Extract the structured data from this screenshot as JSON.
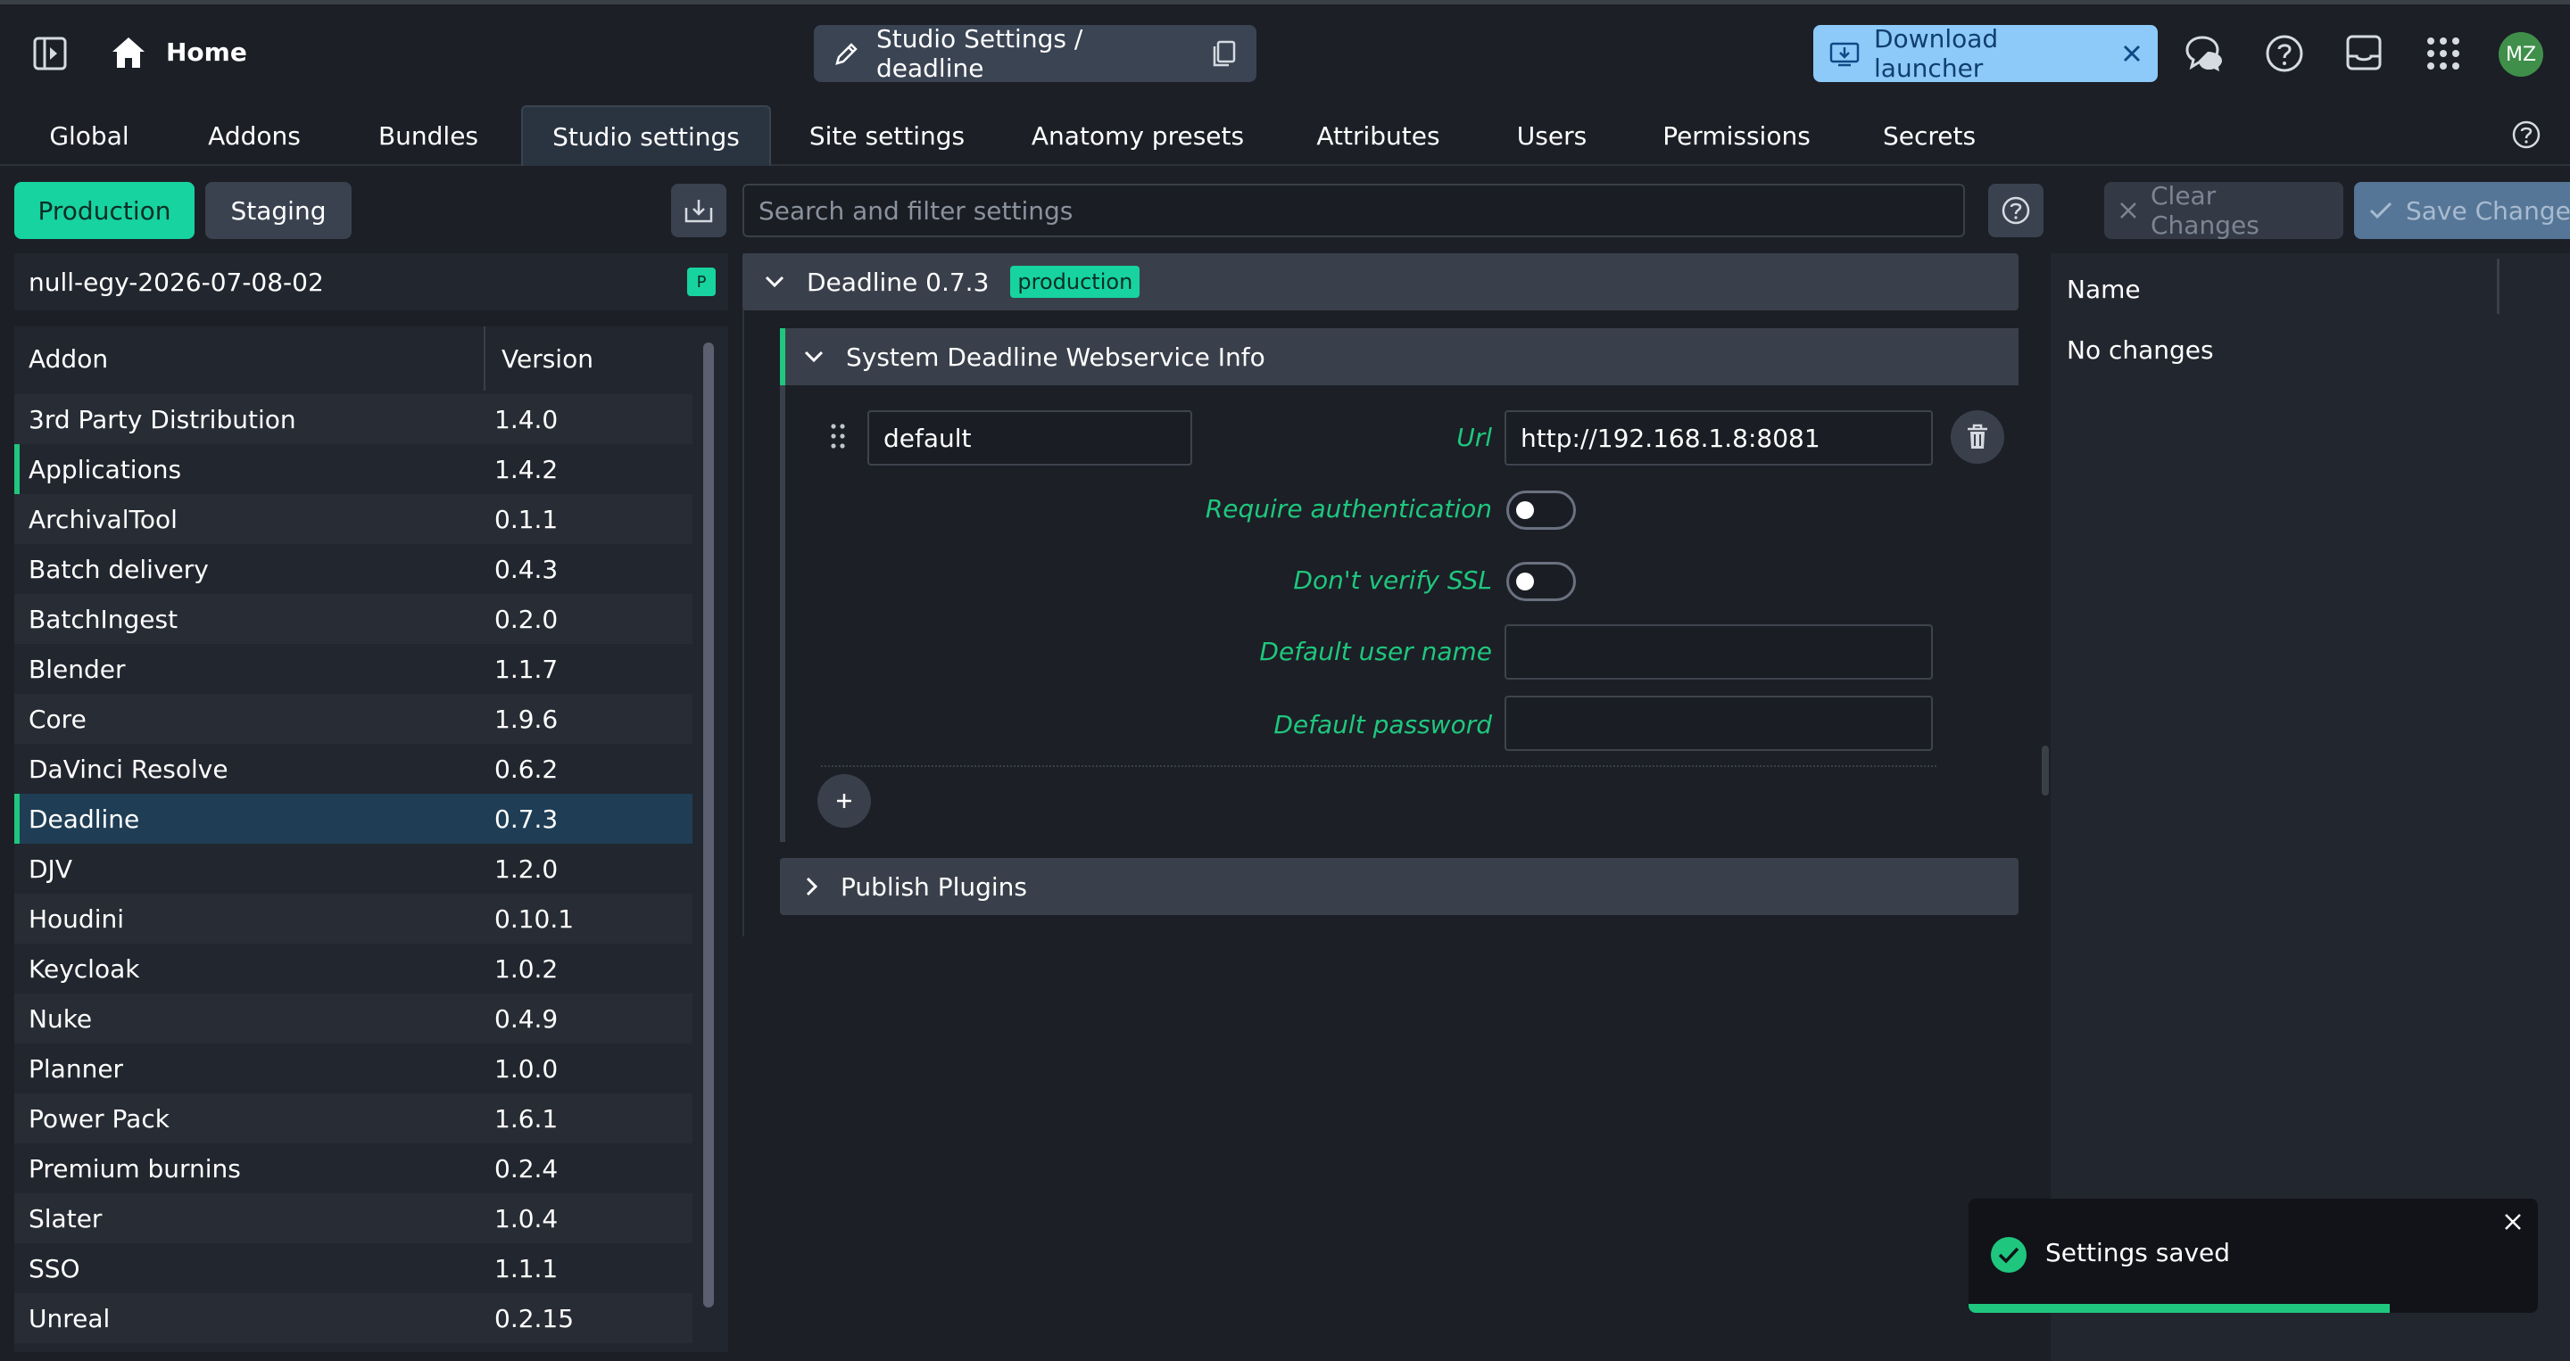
{
  "header": {
    "home_label": "Home",
    "breadcrumb": "Studio Settings / deadline",
    "download_launcher_label": "Download launcher",
    "avatar_initials": "MZ"
  },
  "tabs": [
    "Global",
    "Addons",
    "Bundles",
    "Studio settings",
    "Site settings",
    "Anatomy presets",
    "Attributes",
    "Users",
    "Permissions",
    "Secrets"
  ],
  "active_tab": "Studio settings",
  "left": {
    "production_label": "Production",
    "staging_label": "Staging",
    "bundle_name": "null-egy-2026-07-08-02",
    "bundle_badge": "P",
    "table_headers": {
      "addon": "Addon",
      "version": "Version"
    },
    "addons": [
      {
        "name": "3rd Party Distribution",
        "version": "1.4.0"
      },
      {
        "name": "Applications",
        "version": "1.4.2"
      },
      {
        "name": "ArchivalTool",
        "version": "0.1.1"
      },
      {
        "name": "Batch delivery",
        "version": "0.4.3"
      },
      {
        "name": "BatchIngest",
        "version": "0.2.0"
      },
      {
        "name": "Blender",
        "version": "1.1.7"
      },
      {
        "name": "Core",
        "version": "1.9.6"
      },
      {
        "name": "DaVinci Resolve",
        "version": "0.6.2"
      },
      {
        "name": "Deadline",
        "version": "0.7.3"
      },
      {
        "name": "DJV",
        "version": "1.2.0"
      },
      {
        "name": "Houdini",
        "version": "0.10.1"
      },
      {
        "name": "Keycloak",
        "version": "1.0.2"
      },
      {
        "name": "Nuke",
        "version": "0.4.9"
      },
      {
        "name": "Planner",
        "version": "1.0.0"
      },
      {
        "name": "Power Pack",
        "version": "1.6.1"
      },
      {
        "name": "Premium burnins",
        "version": "0.2.4"
      },
      {
        "name": "Slater",
        "version": "1.0.4"
      },
      {
        "name": "SSO",
        "version": "1.1.1"
      },
      {
        "name": "Unreal",
        "version": "0.2.15"
      }
    ]
  },
  "toolbar": {
    "search_placeholder": "Search and filter settings",
    "clear_label": "Clear Changes",
    "save_label": "Save Changes"
  },
  "editor": {
    "addon_title": "Deadline 0.7.3",
    "addon_badge": "production",
    "section_title": "System Deadline Webservice Info",
    "entry_name": "default",
    "url_label": "Url",
    "url_value": "http://192.168.1.8:8081",
    "require_auth_label": "Require authentication",
    "dont_verify_ssl_label": "Don't verify SSL",
    "default_user_label": "Default user name",
    "default_user_value": "",
    "default_password_label": "Default password",
    "default_password_value": "",
    "publish_plugins_title": "Publish Plugins"
  },
  "changes": {
    "column_name": "Name",
    "empty_text": "No changes"
  },
  "toast": {
    "message": "Settings saved",
    "progress": 0.74
  },
  "colors": {
    "accent_green": "#17d3a0",
    "field_label_green": "#1fc77e",
    "launcher_blue": "#8ecaf9",
    "selected_row": "#1f3e55"
  }
}
